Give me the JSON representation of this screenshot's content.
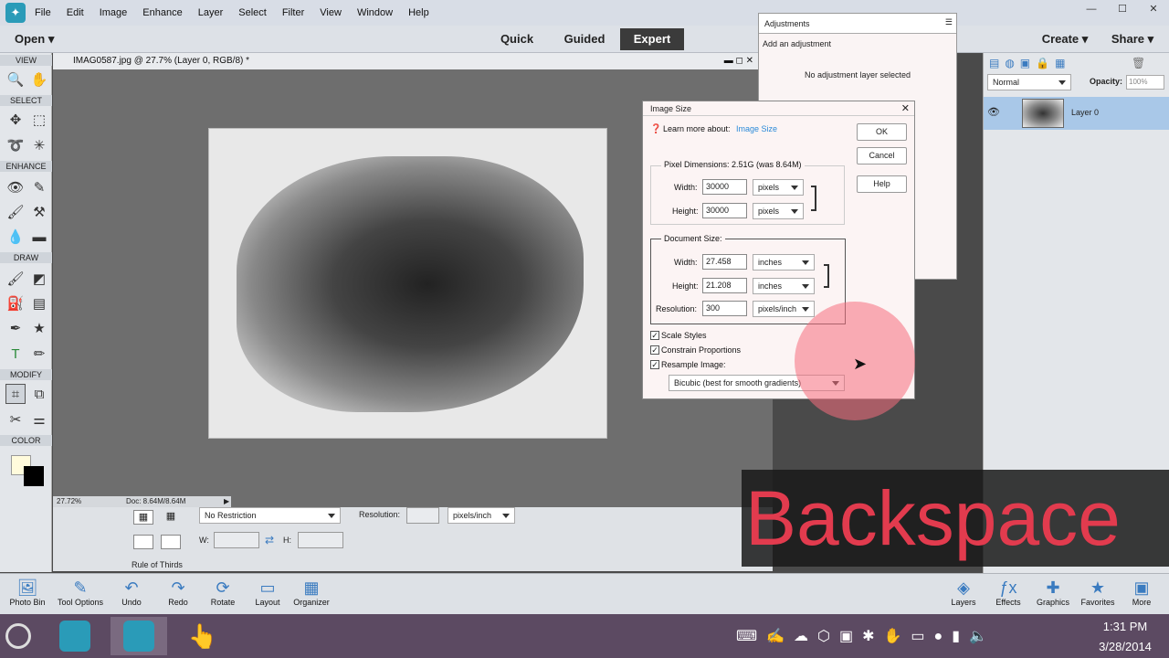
{
  "menubar": {
    "items": [
      "File",
      "Edit",
      "Image",
      "Enhance",
      "Layer",
      "Select",
      "Filter",
      "View",
      "Window",
      "Help"
    ]
  },
  "modebar": {
    "open": "Open",
    "quick": "Quick",
    "guided": "Guided",
    "expert": "Expert",
    "create": "Create",
    "share": "Share"
  },
  "toolbox": {
    "sections": [
      "VIEW",
      "SELECT",
      "ENHANCE",
      "DRAW",
      "MODIFY",
      "COLOR"
    ]
  },
  "document": {
    "title": "IMAG0587.jpg @ 27.7% (Layer 0, RGB/8) *",
    "zoom": "27.72%",
    "doc_info": "Doc: 8.64M/8.64M"
  },
  "tool_options": {
    "crop_preset": "No Restriction",
    "resolution_label": "Resolution:",
    "resolution_unit": "pixels/inch",
    "w_label": "W:",
    "h_label": "H:",
    "grid_label": "Rule of Thirds"
  },
  "adjustments": {
    "tab": "Adjustments",
    "add": "Add an adjustment",
    "status": "No adjustment layer selected"
  },
  "layers": {
    "blend_mode": "Normal",
    "opacity_label": "Opacity:",
    "opacity_value": "100%",
    "layer_name": "Layer 0"
  },
  "dialog": {
    "title": "Image Size",
    "learn_more": "Learn more about:",
    "learn_link": "Image Size",
    "ok": "OK",
    "cancel": "Cancel",
    "help": "Help",
    "pixel_dims": "Pixel Dimensions:  2.51G (was 8.64M)",
    "px_width_label": "Width:",
    "px_width": "30000",
    "px_width_unit": "pixels",
    "px_height_label": "Height:",
    "px_height": "30000",
    "px_height_unit": "pixels",
    "doc_size": "Document Size:",
    "doc_width_label": "Width:",
    "doc_width": "27.458",
    "doc_width_unit": "inches",
    "doc_height_label": "Height:",
    "doc_height": "21.208",
    "doc_height_unit": "inches",
    "res_label": "Resolution:",
    "res": "300",
    "res_unit": "pixels/inch",
    "scale_styles": "Scale Styles",
    "constrain": "Constrain Proportions",
    "resample": "Resample Image:",
    "resample_method": "Bicubic (best for smooth gradients)"
  },
  "bottombar": {
    "left": [
      "Photo Bin",
      "Tool Options",
      "Undo",
      "Redo",
      "Rotate",
      "Layout",
      "Organizer"
    ],
    "right": [
      "Layers",
      "Effects",
      "Graphics",
      "Favorites",
      "More"
    ]
  },
  "taskbar": {
    "time": "1:31 PM",
    "date": "3/28/2014"
  },
  "overlay": {
    "key": "Backspace"
  },
  "colors": {
    "accent": "#2a9bb8",
    "expert_bg": "#3b3b3b",
    "overlay_text": "#e23b4e"
  }
}
